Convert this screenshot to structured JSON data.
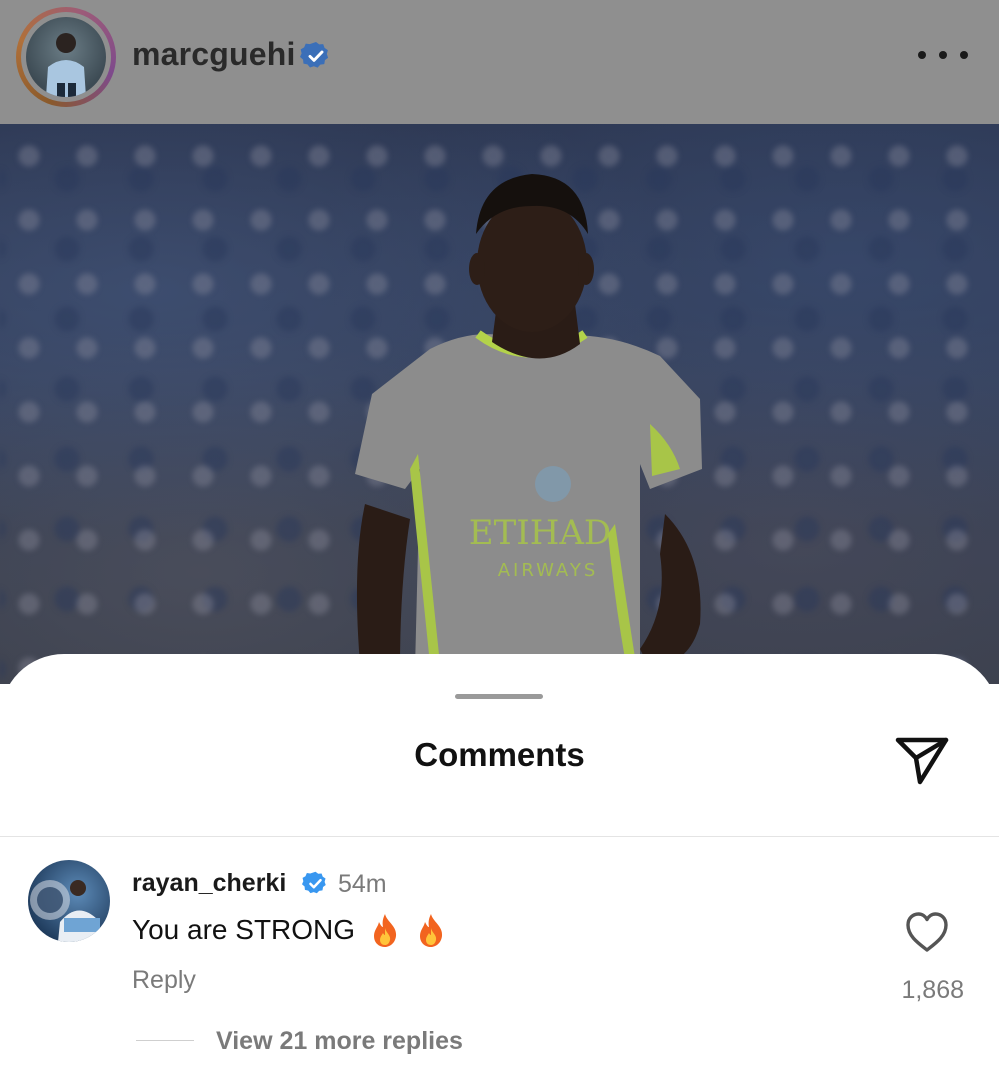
{
  "post": {
    "username": "marcguehi",
    "verified": true,
    "more_icon": "more-horizontal-icon"
  },
  "photo": {
    "kind": "football player photo",
    "shirt_sponsor_line1": "ETIHAD",
    "shirt_sponsor_line2": "AIRWAYS"
  },
  "comments_sheet": {
    "title": "Comments",
    "share_icon": "paper-plane-icon",
    "comments": [
      {
        "username": "rayan_cherki",
        "verified": true,
        "time": "54m",
        "text": "You are STRONG",
        "emojis": [
          "fire-emoji",
          "fire-emoji"
        ],
        "reply_label": "Reply",
        "likes": "1,868",
        "view_replies_label": "View 21 more replies"
      }
    ]
  },
  "colors": {
    "verified_blue": "#3897f0",
    "dim_overlay": "#8f8f8f",
    "muted_text": "#7a7a7a",
    "shirt_green": "#b6d94c"
  }
}
